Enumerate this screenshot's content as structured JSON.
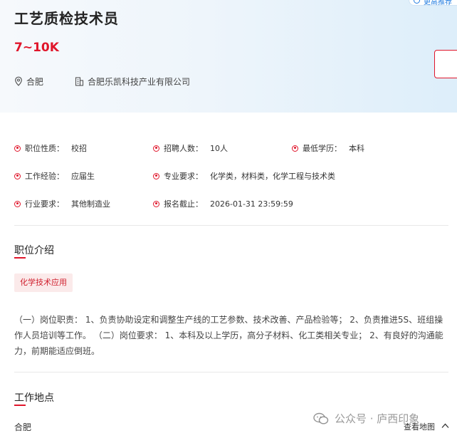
{
  "header": {
    "title": "工艺质检技术员",
    "salary": "7~10K",
    "location": "合肥",
    "company": "合肥乐凯科技产业有限公司",
    "top_badge": "更高推荐"
  },
  "attributes": [
    {
      "key": "职位性质：",
      "value": "校招"
    },
    {
      "key": "招聘人数：",
      "value": "10人"
    },
    {
      "key": "最低学历：",
      "value": "本科"
    },
    {
      "key": "工作经验：",
      "value": "应届生"
    },
    {
      "key": "专业要求：",
      "value": "化学类，材料类，化学工程与技术类"
    },
    {
      "key": "行业要求：",
      "value": "其他制造业"
    },
    {
      "key": "报名截止：",
      "value": "2026-01-31 23:59:59"
    }
  ],
  "intro": {
    "title": "职位介绍",
    "tag": "化学技术应用",
    "description": "（一）岗位职责： 1、负责协助设定和调整生产线的工艺参数、技术改善、产品检验等； 2、负责推进5S、班组操作人员培训等工作。 （二）岗位要求： 1、本科及以上学历，高分子材料、化工类相关专业； 2、有良好的沟通能力，前期能适应倒班。"
  },
  "work_location": {
    "title": "工作地点",
    "city": "合肥",
    "map_link": "查看地图"
  },
  "watermark": {
    "label": "公众号 · 庐西印象"
  },
  "colors": {
    "accent": "#e0162b",
    "tag_bg": "#fbeaea"
  }
}
